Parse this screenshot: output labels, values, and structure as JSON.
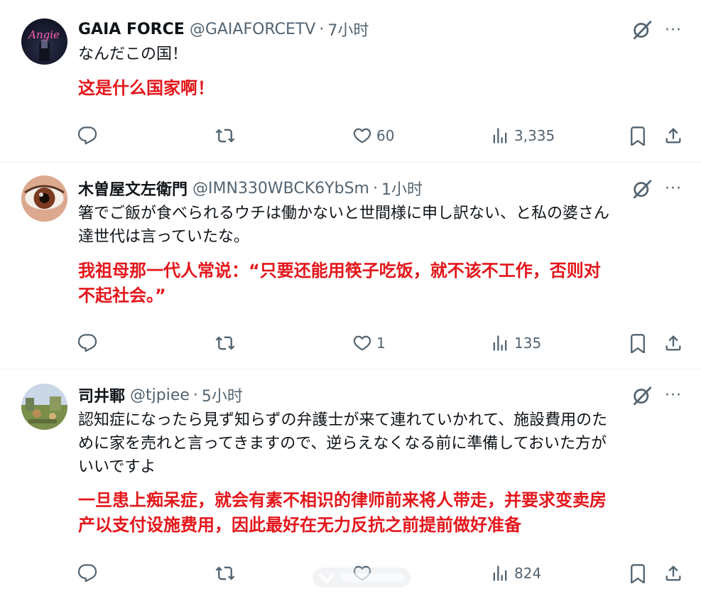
{
  "tweets": [
    {
      "name": "GAIA FORCE",
      "handle": "@GAIAFORCETV",
      "time": "7小时",
      "text": "なんだこの国！",
      "translation": "这是什么国家啊！",
      "likes": "60",
      "views": "3,335",
      "avatar_text": "Angie"
    },
    {
      "name": "木曽屋文左衛門",
      "handle": "@IMN330WBCK6YbSm",
      "time": "1小时",
      "text_lines": [
        "箸でご飯が食べられるウチは働かないと世間様に申し訳ない、と私の婆さん",
        "達世代は言っていたな。"
      ],
      "translation_lines": [
        "我祖母那一代人常说：“只要还能用筷子吃饭，就不该不工作，否则对",
        "不起社会。”"
      ],
      "likes": "1",
      "views": "135"
    },
    {
      "name": "司井鄆",
      "handle": "@tjpiee",
      "time": "5小时",
      "text_lines": [
        "認知症になったら見ず知らずの弁護士が来て連れていかれて、施設費用のた",
        "めに家を売れと言ってきますので、逆らえなくなる前に準備しておいた方が",
        "いいですよ"
      ],
      "translation_lines": [
        "一旦患上痴呆症，就会有素不相识的律师前来将人带走，并要求变卖房",
        "产以支付设施费用，因此最好在无力反抗之前提前做好准备"
      ],
      "views": "824"
    }
  ],
  "dot": "·",
  "more": "···",
  "colors": {
    "translation": "#e3161b",
    "meta": "#536471",
    "text": "#0f1419"
  },
  "icons": [
    "reply-icon",
    "retweet-icon",
    "like-icon",
    "views-icon",
    "bookmark-icon",
    "share-icon",
    "grok-icon",
    "more-icon"
  ]
}
